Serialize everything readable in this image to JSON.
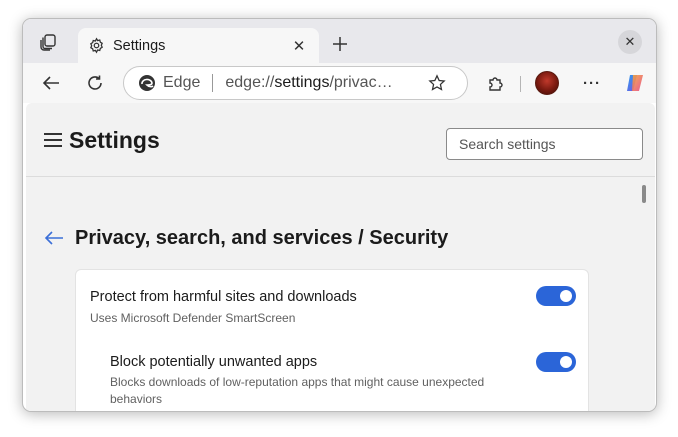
{
  "tab": {
    "title": "Settings",
    "close_glyph": "✕",
    "icons": [
      "workspaces-icon",
      "gear-icon",
      "close-icon",
      "plus-icon"
    ]
  },
  "window": {
    "close_glyph": "✕"
  },
  "toolbar": {
    "address_label": "Edge",
    "url_prefix": "edge://",
    "url_host": "settings",
    "url_path": "/privac…",
    "menu_glyph": "···",
    "icons": [
      "back-icon",
      "refresh-icon",
      "edge-logo-icon",
      "star-icon",
      "extensions-icon",
      "profile-avatar",
      "more-icon",
      "copilot-icon"
    ]
  },
  "settings": {
    "title": "Settings",
    "search_placeholder": "Search settings",
    "page_heading": "Privacy, search, and services / Security",
    "items": [
      {
        "title": "Protect from harmful sites and downloads",
        "description": "Uses Microsoft Defender SmartScreen",
        "enabled": true
      },
      {
        "title": "Block potentially unwanted apps",
        "description": "Blocks downloads of low-reputation apps that might cause unexpected behaviors",
        "enabled": true
      }
    ]
  },
  "colors": {
    "accent": "#2b65d8",
    "tab_strip": "#e8e8ec",
    "content_bg": "#f2f2f2"
  }
}
